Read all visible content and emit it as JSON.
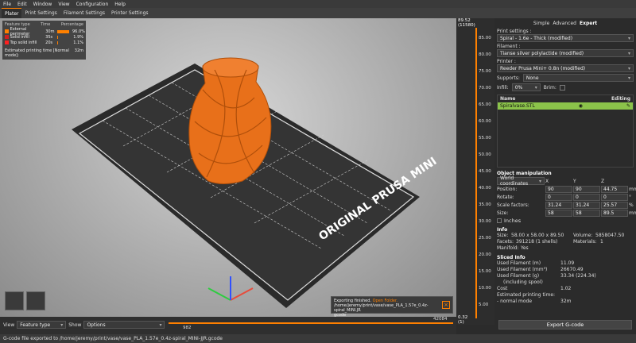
{
  "menu": [
    "File",
    "Edit",
    "Window",
    "View",
    "Configuration",
    "Help"
  ],
  "tabs": [
    "Plater",
    "Print Settings",
    "Filament Settings",
    "Printer Settings"
  ],
  "legend": {
    "headers": [
      "Feature type",
      "Time",
      "Percentage"
    ],
    "rows": [
      {
        "name": "External perimeter",
        "time": "30m",
        "pct": "96.0%",
        "color": "#ff8000",
        "fraction": 0.96
      },
      {
        "name": "Solid infill",
        "time": "35s",
        "pct": "1.9%",
        "color": "#d02020",
        "fraction": 0.019
      },
      {
        "name": "Top solid infill",
        "time": "20s",
        "pct": "1.1%",
        "color": "#ff2020",
        "fraction": 0.011
      }
    ],
    "est_label": "Estimated printing time [Normal mode]:",
    "est_value": "32m"
  },
  "bed_label": "ORIGINAL PRUSA MINI",
  "vslider": {
    "top_value": "89.52",
    "top_layer": "(11580)",
    "bottom_value": "0.32",
    "bottom_layer": "(1)",
    "ticks": [
      "85.00",
      "80.00",
      "75.00",
      "70.00",
      "65.00",
      "60.00",
      "55.00",
      "50.00",
      "45.00",
      "40.00",
      "35.00",
      "30.00",
      "25.00",
      "20.00",
      "15.00",
      "10.00",
      "5.00"
    ]
  },
  "modes": {
    "simple": "Simple",
    "advanced": "Advanced",
    "expert": "Expert"
  },
  "print_settings": {
    "label": "Print settings :",
    "value": "Spiral - 1.6e - Thick (modified)"
  },
  "filament": {
    "label": "Filament :",
    "value": "Tianse silver polylactide (modified)"
  },
  "printer": {
    "label": "Printer :",
    "value": "Reeder Prusa Mini+ 0.8n (modified)"
  },
  "supports": {
    "label": "Supports:",
    "value": "None"
  },
  "infill": {
    "label": "Infill:",
    "value": "0%",
    "brim_label": "Brim:"
  },
  "objects": {
    "col_name": "Name",
    "col_editing": "Editing",
    "item": "Spiralvase.STL"
  },
  "object_manip": {
    "title": "Object manipulation",
    "coords": "World coordinates",
    "axes": [
      "X",
      "Y",
      "Z"
    ],
    "position": {
      "label": "Position:",
      "values": [
        "90",
        "90",
        "44.75"
      ],
      "unit": "mm"
    },
    "rotate": {
      "label": "Rotate:",
      "values": [
        "0",
        "0",
        "0"
      ],
      "unit": "°"
    },
    "scale": {
      "label": "Scale factors:",
      "values": [
        "31.24",
        "31.24",
        "25.57"
      ],
      "unit": "%"
    },
    "size": {
      "label": "Size:",
      "values": [
        "58",
        "58",
        "89.5"
      ],
      "unit": "mm"
    },
    "inches": "Inches"
  },
  "info": {
    "title": "Info",
    "size_label": "Size:",
    "size": "58.00 x 58.00 x 89.50",
    "volume_label": "Volume:",
    "volume": "5858047.50",
    "facets_label": "Facets:",
    "facets": "391218 (1 shells)",
    "materials_label": "Materials:",
    "materials": "1",
    "manifold_label": "Manifold:",
    "manifold": "Yes"
  },
  "sliced": {
    "title": "Sliced Info",
    "rows": [
      {
        "k": "Used Filament (m)",
        "v": "11.09"
      },
      {
        "k": "Used Filament (mm³)",
        "v": "26670.49"
      },
      {
        "k": "Used Filament (g)",
        "v": "33.34 (224.34)"
      },
      {
        "k": "(including spool)",
        "v": ""
      },
      {
        "k": "Cost",
        "v": "1.02"
      },
      {
        "k": "Estimated printing time:",
        "v": ""
      },
      {
        "k": " - normal mode",
        "v": "32m"
      }
    ]
  },
  "export_button": "Export G-code",
  "bottom": {
    "view_label": "View",
    "view_value": "Feature type",
    "show_label": "Show",
    "show_value": "Options",
    "h_left": "982",
    "h_right": "42084"
  },
  "notification": {
    "line1": "Exporting finished.",
    "link": "Open Folder.",
    "line2": "/home/jeremy/print/vase/vase_PLA_1.57e_0.4z-spiral_MINI.JR",
    "line3": "gcode"
  },
  "status": "G-code file exported to /home/jeremy/print/vase/vase_PLA_1.57e_0.4z-spiral_MINI-JJR.gcode",
  "colors": {
    "accent": "#ff8000",
    "selected_row": "#8bc34a"
  }
}
